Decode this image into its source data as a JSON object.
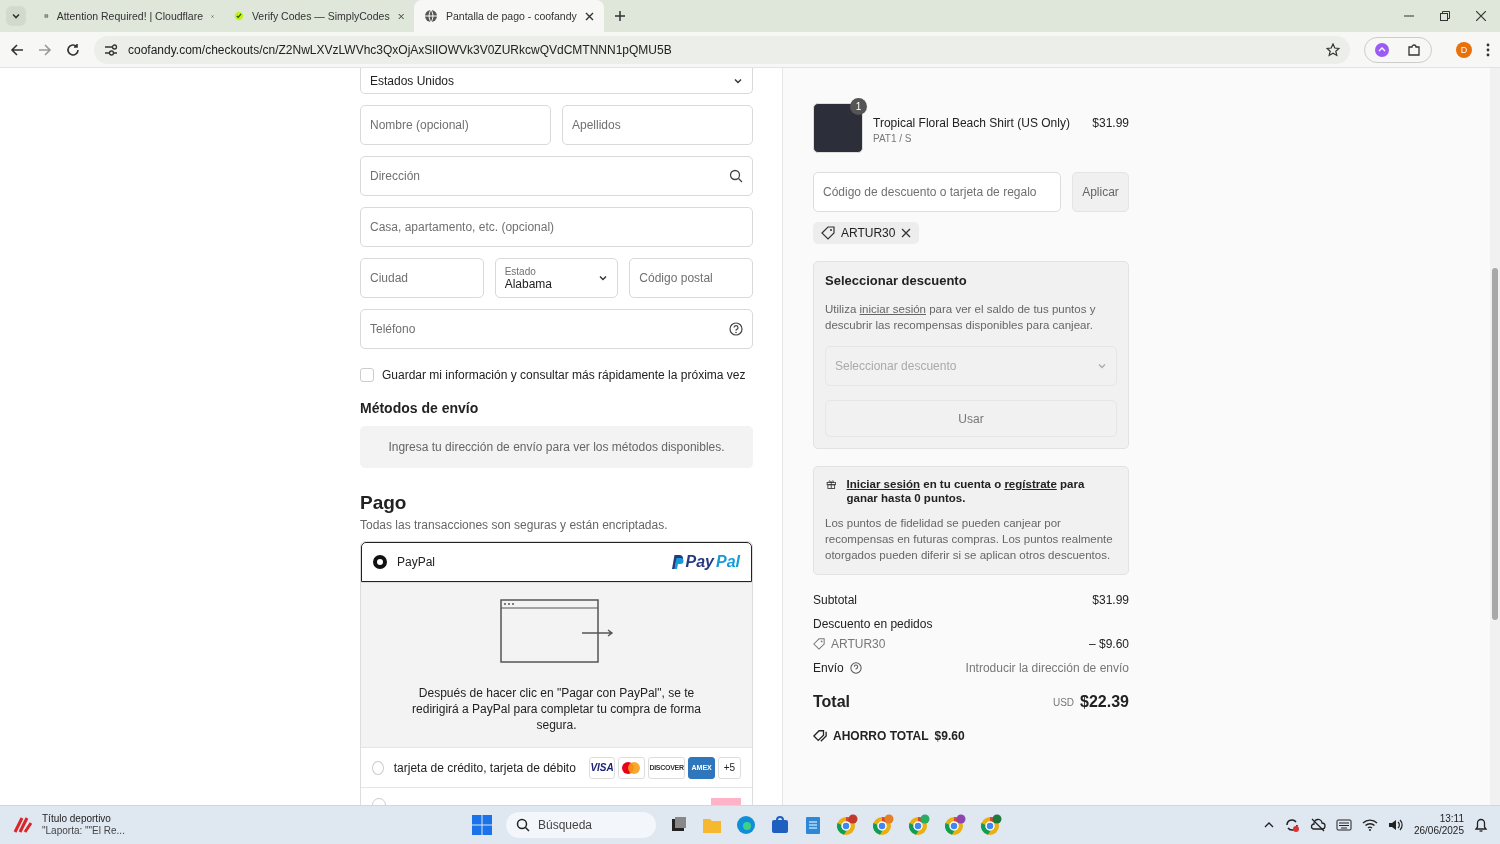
{
  "browser": {
    "tabs": [
      {
        "title": "Attention Required! | Cloudflare",
        "selected": false
      },
      {
        "title": "Verify Codes — SimplyCodes",
        "selected": false
      },
      {
        "title": "Pantalla de pago - coofandy",
        "selected": true
      }
    ],
    "url": "coofandy.com/checkouts/cn/Z2NwLXVzLWVhc3QxOjAxSlIOWVk3V0ZURkcwQVdCMTNNN1pQMU5B",
    "profile_initial": "D"
  },
  "form": {
    "country": {
      "value": "Estados Unidos"
    },
    "rows": [
      [
        {
          "kind": "text",
          "placeholder": "Nombre (opcional)"
        },
        {
          "kind": "text",
          "placeholder": "Apellidos"
        }
      ],
      [
        {
          "kind": "search",
          "placeholder": "Dirección"
        }
      ],
      [
        {
          "kind": "text",
          "placeholder": "Casa, apartamento, etc. (opcional)"
        }
      ],
      [
        {
          "kind": "text",
          "placeholder": "Ciudad"
        },
        {
          "kind": "select",
          "label": "Estado",
          "value": "Alabama"
        },
        {
          "kind": "text",
          "placeholder": "Código postal"
        }
      ],
      [
        {
          "kind": "help",
          "placeholder": "Teléfono"
        }
      ]
    ],
    "save_info": {
      "label": "Guardar mi información y consultar más rápidamente la próxima vez",
      "checked": false
    }
  },
  "shipping": {
    "heading": "Métodos de envío",
    "message": "Ingresa tu dirección de envío para ver los métodos disponibles."
  },
  "payment": {
    "heading": "Pago",
    "subtitle": "Todas las transacciones son seguras y están encriptadas.",
    "methods": [
      {
        "kind": "paypal",
        "label": "PayPal",
        "selected": true,
        "logo": "PayPal",
        "info": "Después de hacer clic en \"Pagar con PayPal\", se te redirigirá a PayPal para completar tu compra de forma segura."
      },
      {
        "kind": "cards",
        "label": "tarjeta de crédito, tarjeta de débito",
        "selected": false,
        "brands": [
          "VISA",
          "DISCOVER",
          "AMEX"
        ],
        "more": "+5"
      },
      {
        "kind": "other",
        "selected": false
      }
    ]
  },
  "summary": {
    "item": {
      "name": "Tropical Floral Beach Shirt (US Only)",
      "variant": "PAT1 / S",
      "price": "$31.99",
      "quantity": "1"
    },
    "discount_field": {
      "placeholder": "Código de descuento o tarjeta de regalo",
      "button": "Aplicar"
    },
    "applied_code": "ARTUR30",
    "select_discount": {
      "title": "Seleccionar descuento",
      "text_before": "Utiliza",
      "link": "iniciar sesión",
      "text_after": "para ver el saldo de tus puntos y descubrir las recompensas disponibles para canjear.",
      "dropdown_placeholder": "Seleccionar descuento",
      "button": "Usar"
    },
    "points": {
      "login_link": "Iniciar sesión",
      "middle": "en tu cuenta o",
      "register_link": "regístrate",
      "end": "para ganar hasta 0 puntos.",
      "description": "Los puntos de fidelidad se pueden canjear por recompensas en futuras compras. Los puntos realmente otorgados pueden diferir si se aplican otros descuentos."
    },
    "subtotal": {
      "label": "Subtotal",
      "value": "$31.99"
    },
    "order_discount": {
      "label": "Descuento en pedidos",
      "code": "ARTUR30",
      "value": "– $9.60"
    },
    "shipping": {
      "label": "Envío",
      "value": "Introducir la dirección de envío"
    },
    "total": {
      "label": "Total",
      "currency": "USD",
      "value": "$22.39"
    },
    "savings": {
      "label": "AHORRO TOTAL",
      "value": "$9.60"
    }
  },
  "taskbar": {
    "widget": {
      "title": "Título deportivo",
      "subtitle": "\"Laporta: \"\"El Re..."
    },
    "search": "Búsqueda",
    "time": "13:11",
    "date": "26/06/2025"
  }
}
